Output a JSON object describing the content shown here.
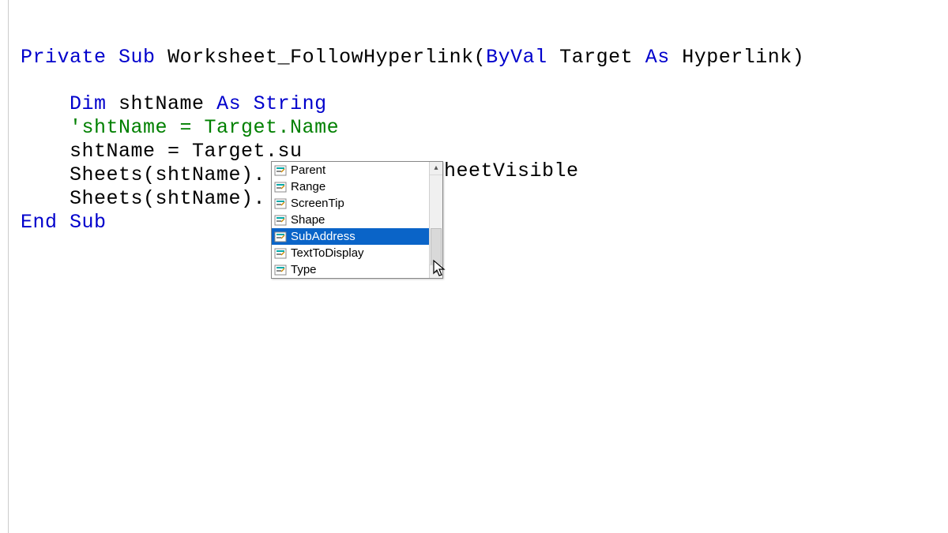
{
  "code": {
    "l1_kw1": "Private",
    "l1_kw2": "Sub",
    "l1_name": " Worksheet_FollowHyperlink(",
    "l1_kw3": "ByVal",
    "l1_rest": " Target ",
    "l1_kw4": "As",
    "l1_rest2": " Hyperlink)",
    "l3_indent": "    ",
    "l3_kw1": "Dim",
    "l3_mid": " shtName ",
    "l3_kw2": "As",
    "l3_kw3": " String",
    "l4_indent": "    ",
    "l4_cmt": "'shtName = Target.Name",
    "l5": "    shtName = Target.su",
    "l6": "    Sheets(shtName).",
    "l7": "    Sheets(shtName).",
    "l8_kw1": "End",
    "l8_kw2": " Sub",
    "behind": "heetVisible"
  },
  "autocomplete": {
    "items": [
      {
        "label": "Parent"
      },
      {
        "label": "Range"
      },
      {
        "label": "ScreenTip"
      },
      {
        "label": "Shape"
      },
      {
        "label": "SubAddress"
      },
      {
        "label": "TextToDisplay"
      },
      {
        "label": "Type"
      }
    ],
    "selected_index": 4
  }
}
